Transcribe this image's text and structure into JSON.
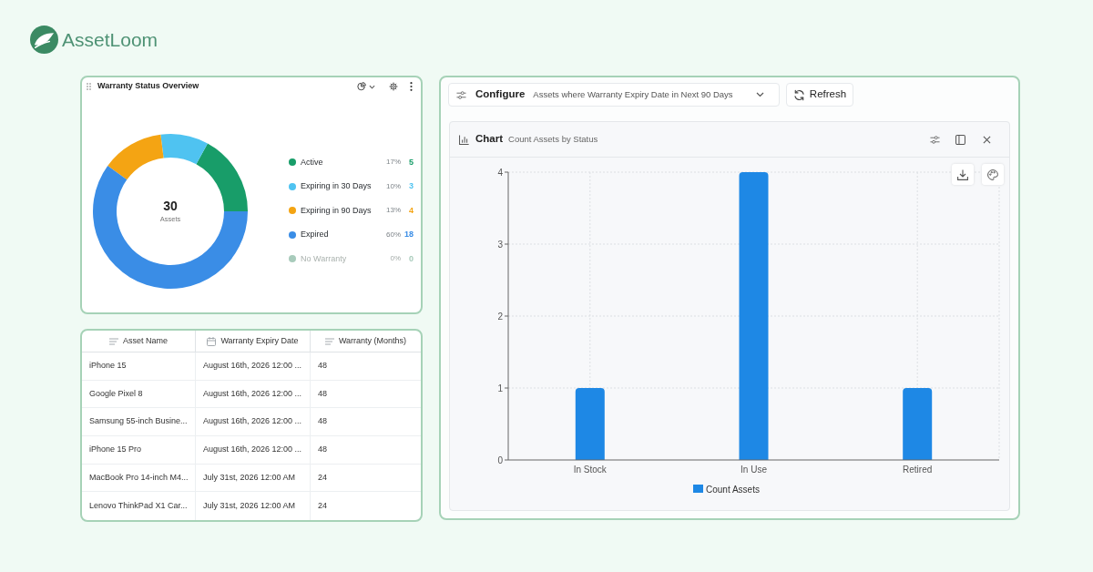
{
  "brand": {
    "name": "AssetLoom"
  },
  "warranty_widget": {
    "title": "Warranty Status Overview",
    "chart_data": {
      "type": "donut",
      "categories": [
        "Active",
        "Expiring in 30 Days",
        "Expiring in 90 Days",
        "Expired",
        "No Warranty"
      ],
      "values": [
        17,
        10,
        13,
        60,
        0
      ]
    },
    "center": {
      "value": "30",
      "label": "Assets"
    },
    "legend": [
      {
        "percent": "17%",
        "count": "5",
        "color": "#189d69",
        "dimmed": false
      },
      {
        "percent": "10%",
        "count": "3",
        "color": "#4fc3f1",
        "dimmed": false
      },
      {
        "percent": "13%",
        "count": "4",
        "color": "#f4a413",
        "dimmed": false
      },
      {
        "percent": "60%",
        "count": "18",
        "color": "#3a8de6",
        "dimmed": false
      },
      {
        "percent": "0%",
        "count": "0",
        "color": "#a8cbbb",
        "dimmed": true
      }
    ]
  },
  "asset_table": {
    "columns": [
      {
        "label": "Asset Name",
        "kind": "text"
      },
      {
        "label": "Warranty Expiry Date",
        "kind": "date"
      },
      {
        "label": "Warranty (Months)",
        "kind": "text"
      }
    ],
    "rows": [
      [
        "iPhone 15",
        "August 16th, 2026 12:00 ...",
        "48"
      ],
      [
        "Google Pixel 8",
        "August 16th, 2026 12:00 ...",
        "48"
      ],
      [
        "Samsung 55-inch Busine...",
        "August 16th, 2026 12:00 ...",
        "48"
      ],
      [
        "iPhone 15 Pro",
        "August 16th, 2026 12:00 ...",
        "48"
      ],
      [
        "MacBook Pro 14-inch M4...",
        "July 31st, 2026 12:00 AM",
        "24"
      ],
      [
        "Lenovo ThinkPad X1 Car...",
        "July 31st, 2026 12:00 AM",
        "24"
      ]
    ]
  },
  "report": {
    "configure_label": "Configure",
    "query": "Assets where Warranty Expiry Date in Next 90 Days",
    "refresh_label": "Refresh",
    "chart_panel": {
      "title": "Chart",
      "subtitle": "Count Assets by Status",
      "chart_data": {
        "type": "bar",
        "categories": [
          "In Stock",
          "In Use",
          "Retired"
        ],
        "series": [
          {
            "name": "Count Assets",
            "color": "#1e88e5",
            "values": [
              1,
              4,
              1
            ]
          }
        ],
        "ylim": [
          0,
          4
        ],
        "yticks": [
          0,
          1,
          2,
          3,
          4
        ],
        "grid": true
      }
    }
  }
}
